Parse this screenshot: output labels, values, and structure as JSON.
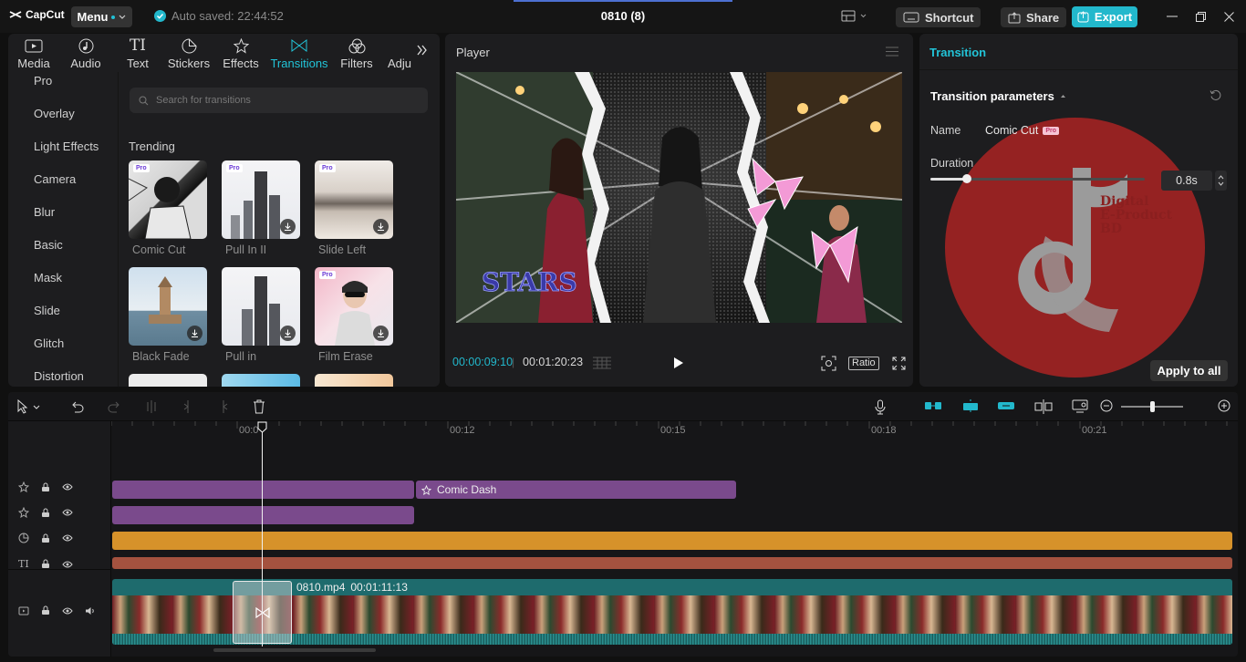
{
  "titlebar": {
    "app_name": "CapCut",
    "menu_label": "Menu",
    "autosave": "Auto saved: 22:44:52",
    "project_title": "0810 (8)",
    "shortcut_label": "Shortcut",
    "share_label": "Share",
    "export_label": "Export"
  },
  "media_panel": {
    "tabs": [
      {
        "label": "Media",
        "icon": "media-icon"
      },
      {
        "label": "Audio",
        "icon": "audio-icon"
      },
      {
        "label": "Text",
        "icon": "text-icon"
      },
      {
        "label": "Stickers",
        "icon": "stickers-icon"
      },
      {
        "label": "Effects",
        "icon": "effects-icon"
      },
      {
        "label": "Transitions",
        "icon": "transitions-icon",
        "active": true
      },
      {
        "label": "Filters",
        "icon": "filters-icon"
      },
      {
        "label": "Adju",
        "icon": "adjust-icon"
      }
    ],
    "categories": [
      "Pro",
      "Overlay",
      "Light Effects",
      "Camera",
      "Blur",
      "Basic",
      "Mask",
      "Slide",
      "Glitch",
      "Distortion"
    ],
    "search_placeholder": "Search for transitions",
    "section_title": "Trending",
    "items": [
      {
        "label": "Comic Cut",
        "pro": "Pro"
      },
      {
        "label": "Pull In II",
        "pro": "Pro"
      },
      {
        "label": "Slide Left",
        "pro": "Pro"
      },
      {
        "label": "Black Fade",
        "pro": ""
      },
      {
        "label": "Pull in",
        "pro": ""
      },
      {
        "label": "Film Erase",
        "pro": "Pro"
      }
    ]
  },
  "player": {
    "title": "Player",
    "overlay_text": "STARS",
    "current_time": "00:00:09:10",
    "total_time": "00:01:20:23",
    "ratio_label": "Ratio"
  },
  "inspector": {
    "title": "Transition",
    "section": "Transition parameters",
    "name_label": "Name",
    "name_value": "Comic Cut",
    "pro_badge": "Pro",
    "duration_label": "Duration",
    "duration_value": "0.8s",
    "duration_fraction": 0.17,
    "apply_label": "Apply to all",
    "watermark_lines": [
      "Digital",
      "E-Product",
      "BD"
    ]
  },
  "timeline": {
    "ruler_ticks": [
      "00:0",
      "00:12",
      "00:15",
      "00:18",
      "00:21"
    ],
    "effect_clip_label": "Comic Dash",
    "main_clip_name": "0810.mp4",
    "main_clip_duration": "00:01:11:13",
    "colors": {
      "effect": "#7a4a8c",
      "sticker": "#d6922a",
      "text": "#a4523f",
      "video_header": "#1e6b6d",
      "accent": "#22b8cc"
    }
  }
}
